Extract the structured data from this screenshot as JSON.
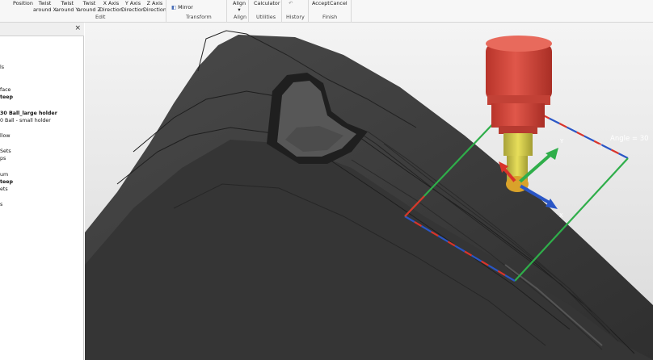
{
  "ribbon": {
    "buttons": [
      {
        "id": "position",
        "label": "Position",
        "line2": ""
      },
      {
        "id": "twist-around-x",
        "label": "Twist",
        "line2": "around X"
      },
      {
        "id": "twist-around-y",
        "label": "Twist",
        "line2": "around Y"
      },
      {
        "id": "twist-around-z",
        "label": "Twist",
        "line2": "around Z"
      },
      {
        "id": "x-axis-direction",
        "label": "X Axis",
        "line2": "Direction"
      },
      {
        "id": "y-axis-direction",
        "label": "Y Axis",
        "line2": "Direction"
      },
      {
        "id": "z-axis-direction",
        "label": "Z Axis",
        "line2": "Direction"
      },
      {
        "id": "mirror",
        "label": "Mirror",
        "line2": ""
      },
      {
        "id": "align",
        "label": "Align",
        "line2": "▾"
      },
      {
        "id": "calculator",
        "label": "Calculator",
        "line2": ""
      },
      {
        "id": "undo",
        "label": "↶",
        "line2": ""
      },
      {
        "id": "accept",
        "label": "Accept",
        "line2": ""
      },
      {
        "id": "cancel",
        "label": "Cancel",
        "line2": ""
      }
    ],
    "groups": [
      "Edit",
      "Transform",
      "Align",
      "Utilities",
      "History",
      "Finish"
    ]
  },
  "panel": {
    "close_label": "×",
    "items": [
      {
        "text": "ls",
        "bold": false
      },
      {
        "text": "face",
        "bold": false
      },
      {
        "text": "teep",
        "bold": true
      },
      {
        "text": "30 Ball_large holder",
        "bold": true
      },
      {
        "text": "0 Ball - small holder",
        "bold": false
      },
      {
        "text": "llow",
        "bold": false
      },
      {
        "text": "Sets",
        "bold": false
      },
      {
        "text": "ps",
        "bold": false
      },
      {
        "text": "um",
        "bold": false
      },
      {
        "text": "teep",
        "bold": true
      },
      {
        "text": "ets",
        "bold": false
      },
      {
        "text": "s",
        "bold": false
      }
    ]
  },
  "viewport": {
    "angle_label": "Angle = 30",
    "axis_labels": {
      "x": "X",
      "y": "Y"
    },
    "colors": {
      "tool_body": "#d9483b",
      "holder_ring": "#e05a4a",
      "shank": "#ddd24a",
      "tip": "#e0a021",
      "axis_x": "#2a56c6",
      "axis_y": "#2fae4a",
      "axis_z": "#d9342b",
      "model": "#3f3f3f"
    }
  }
}
